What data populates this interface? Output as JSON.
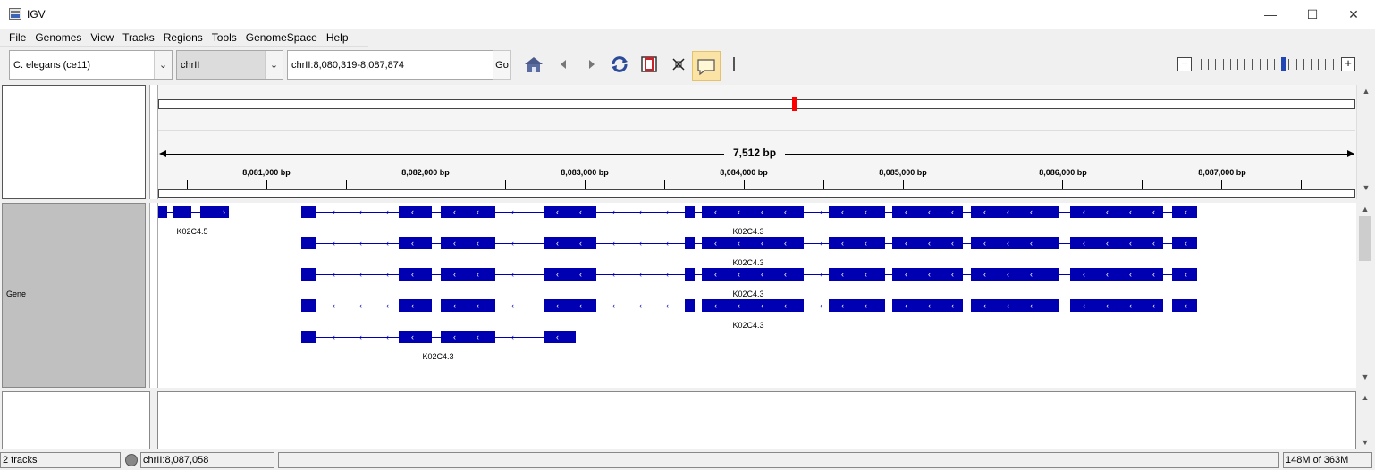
{
  "window": {
    "title": "IGV",
    "controls": [
      "—",
      "☐",
      "✕"
    ]
  },
  "menu": [
    "File",
    "Genomes",
    "View",
    "Tracks",
    "Regions",
    "Tools",
    "GenomeSpace",
    "Help"
  ],
  "toolbar": {
    "genome": "C. elegans (ce11)",
    "chromosome": "chrII",
    "locus": "chrII:8,080,319-8,087,874",
    "go_label": "Go",
    "icons": [
      "home-icon",
      "back-icon",
      "forward-icon",
      "refresh-icon",
      "region-of-interest-icon",
      "resize-icon",
      "popup-info-icon"
    ],
    "zoom_level": 12,
    "zoom_levels": 19
  },
  "ruler": {
    "span_label": "7,512 bp",
    "tick_labels": [
      "8,081,000 bp",
      "8,082,000 bp",
      "8,083,000 bp",
      "8,084,000 bp",
      "8,085,000 bp",
      "8,086,000 bp",
      "8,087,000 bp"
    ]
  },
  "tracks": {
    "gene_track_name": "Gene",
    "features": [
      {
        "name": "K02C4.5",
        "strand": "+",
        "row": 0
      },
      {
        "name": "K02C4.3",
        "strand": "-",
        "row": 0
      },
      {
        "name": "K02C4.3",
        "strand": "-",
        "row": 1
      },
      {
        "name": "K02C4.3",
        "strand": "-",
        "row": 2
      },
      {
        "name": "K02C4.3",
        "strand": "-",
        "row": 3
      },
      {
        "name": "K02C4.3",
        "strand": "-",
        "row": 4
      }
    ]
  },
  "status": {
    "track_count": "2 tracks",
    "position": "chrII:8,087,058",
    "memory": "148M of 363M"
  },
  "colors": {
    "feature": "#0000b2",
    "ideogram_marker": "#ff0000",
    "track_name_bg": "#c0c0c0"
  }
}
